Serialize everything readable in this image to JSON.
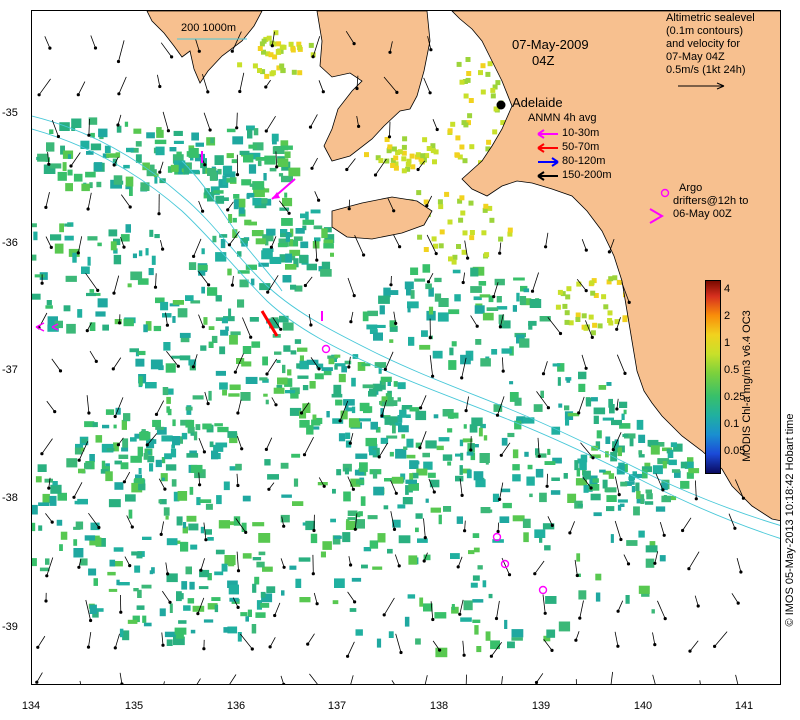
{
  "title": {
    "date": "07-May-2009",
    "time": "04Z"
  },
  "altimetry_note": {
    "lines": [
      "Altimetric sealevel",
      "(0.1m contours)",
      "and velocity for",
      "07-May 04Z",
      "0.5m/s (1kt 24h)"
    ]
  },
  "city": {
    "name": "Adelaide"
  },
  "scale_bar": {
    "label": "200  1000m"
  },
  "anmn_legend": {
    "title": "ANMN 4h avg",
    "items": [
      {
        "label": "10-30m",
        "color": "#ff00ff"
      },
      {
        "label": "50-70m",
        "color": "#ff0000"
      },
      {
        "label": "80-120m",
        "color": "#0000ff"
      },
      {
        "label": "150-200m",
        "color": "#000000"
      }
    ]
  },
  "argo_legend": {
    "line1": "Argo",
    "line2": "drifters@12h to",
    "line3": "06-May 00Z",
    "color": "#ff00ff"
  },
  "colorbar": {
    "title": "MODIS Chl-a mg/m3 v6.4 OC3",
    "ticks": [
      "4",
      "2",
      "1",
      "0.5",
      "0.25",
      "0.1",
      "0.05"
    ]
  },
  "axes": {
    "x_ticks": [
      "134",
      "135",
      "136",
      "137",
      "138",
      "139",
      "140",
      "141"
    ],
    "y_ticks": [
      "-35",
      "-36",
      "-37",
      "-38",
      "-39"
    ]
  },
  "credit": "© IMOS 05-May-2013 10:18:42 Hobart time",
  "colors": {
    "land": "#f7c08f",
    "canyon": "#48c8d8",
    "chl_low": "#2ab080",
    "chl_high": "#f1d21e"
  }
}
